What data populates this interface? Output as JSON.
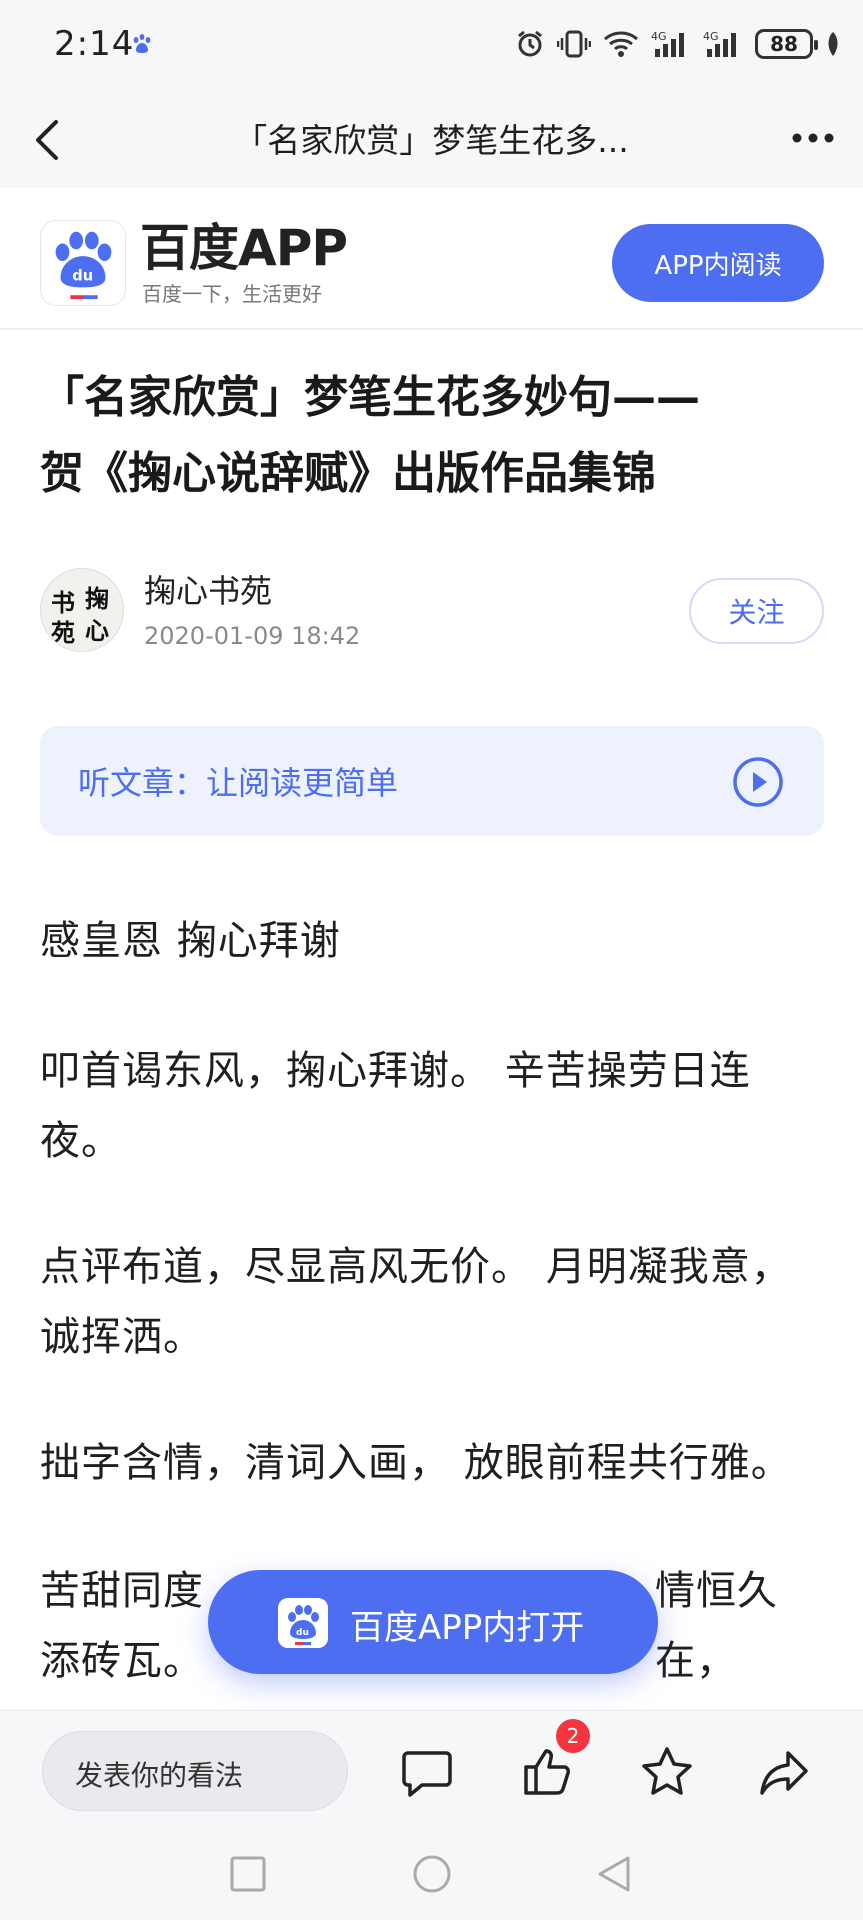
{
  "status_bar": {
    "time": "2:14",
    "battery": "88",
    "icons": [
      "baidu-paw-icon",
      "alarm-icon",
      "vibrate-icon",
      "wifi-icon",
      "signal-4g-icon",
      "signal-4g-icon",
      "battery-icon",
      "leaf-icon"
    ]
  },
  "nav": {
    "title": "「名家欣赏」梦笔生花多..."
  },
  "brand": {
    "name": "百度APP",
    "slogan": "百度一下，生活更好",
    "read_in_app_label": "APP内阅读",
    "accent_color": "#4e6ef2"
  },
  "article": {
    "title_line1": "「名家欣赏」梦笔生花多妙句——",
    "title_line2": "贺《掬心说辞赋》出版作品集锦",
    "author": {
      "name": "掬心书苑",
      "date": "2020-01-09 18:42",
      "avatar_chars": [
        "书",
        "掬",
        "苑",
        "心"
      ],
      "follow_label": "关注"
    },
    "listen_label": "听文章：让阅读更简单",
    "paragraphs": [
      "感皇恩 掬心拜谢",
      "叩首谒东风，掬心拜谢。 辛苦操劳日连夜。",
      "点评布道，尽显高风无价。 月明凝我意，诚挥洒。",
      "拙字含情，清词入画， 放眼前程共行雅。",
      "苦甜同度",
      "情恒久在，",
      "添砖瓦。"
    ]
  },
  "floating": {
    "open_in_app_label": "百度APP内打开"
  },
  "bottom_bar": {
    "comment_placeholder": "发表你的看法",
    "like_count": "2"
  }
}
